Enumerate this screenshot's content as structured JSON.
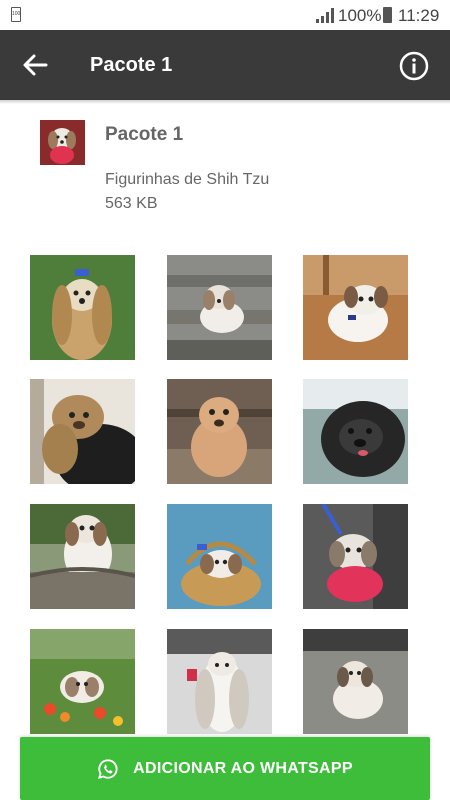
{
  "status_bar": {
    "battery_small_text": "100",
    "battery_percent": "100%",
    "time": "11:29"
  },
  "app_bar": {
    "title": "Pacote 1",
    "back_icon": "arrow-left-icon",
    "info_icon": "info-circle-icon"
  },
  "pack": {
    "name": "Pacote 1",
    "author": "Figurinhas de Shih Tzu",
    "size": "563 KB"
  },
  "stickers": [
    {
      "subject": "shih-tzu-long-hair-blue-bow",
      "bg": "#4f7d3a"
    },
    {
      "subject": "shih-tzu-on-steps",
      "bg": "#8b8b87"
    },
    {
      "subject": "shih-tzu-on-floor",
      "bg": "#b57a45"
    },
    {
      "subject": "shih-tzu-face-closeup",
      "bg": "#6b5a45"
    },
    {
      "subject": "shih-tzu-tan-sitting",
      "bg": "#6e5f52"
    },
    {
      "subject": "shih-tzu-black-face",
      "bg": "#6f8a8c"
    },
    {
      "subject": "shih-tzu-on-wicker-chair",
      "bg": "#8a9a78"
    },
    {
      "subject": "shih-tzu-in-basket",
      "bg": "#5a9bc0"
    },
    {
      "subject": "shih-tzu-pink-sweater",
      "bg": "#5a5a5a"
    },
    {
      "subject": "shih-tzu-with-flowers",
      "bg": "#5e8c3d"
    },
    {
      "subject": "shih-tzu-long-white-hair",
      "bg": "#d9d9d9"
    },
    {
      "subject": "shih-tzu-on-pavement",
      "bg": "#8c8c86"
    }
  ],
  "add_button": {
    "label": "ADICIONAR AO WHATSAPP",
    "icon": "whatsapp-icon"
  },
  "colors": {
    "app_bar": "#3a3a3a",
    "button": "#3ebd3a",
    "text_secondary": "#666666"
  }
}
